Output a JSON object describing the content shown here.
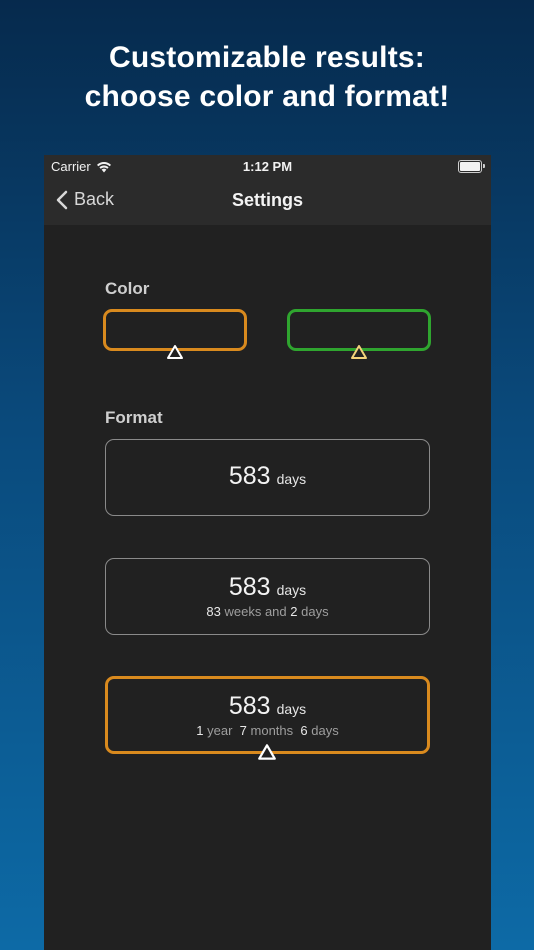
{
  "headline": {
    "line1": "Customizable results:",
    "line2": "choose color and format!"
  },
  "statusbar": {
    "carrier": "Carrier",
    "time": "1:12 PM"
  },
  "navbar": {
    "back_label": "Back",
    "title": "Settings"
  },
  "color_section": {
    "label": "Color",
    "options": [
      {
        "color": "#d98a1e",
        "selected": true
      },
      {
        "color": "#2fa52f",
        "selected": false
      }
    ]
  },
  "format_section": {
    "label": "Format",
    "options": [
      {
        "number": "583",
        "unit": "days",
        "detail": [],
        "selected": false
      },
      {
        "number": "583",
        "unit": "days",
        "detail": [
          {
            "n": "83",
            "t": "weeks and"
          },
          {
            "n": "2",
            "t": "days"
          }
        ],
        "selected": false
      },
      {
        "number": "583",
        "unit": "days",
        "detail": [
          {
            "n": "1",
            "t": "year"
          },
          {
            "n": "7",
            "t": "months"
          },
          {
            "n": "6",
            "t": "days"
          }
        ],
        "selected": true
      }
    ]
  },
  "colors": {
    "accent_orange": "#d98a1e",
    "accent_green": "#2fa52f",
    "marker_yellow": "#f2d27a"
  }
}
